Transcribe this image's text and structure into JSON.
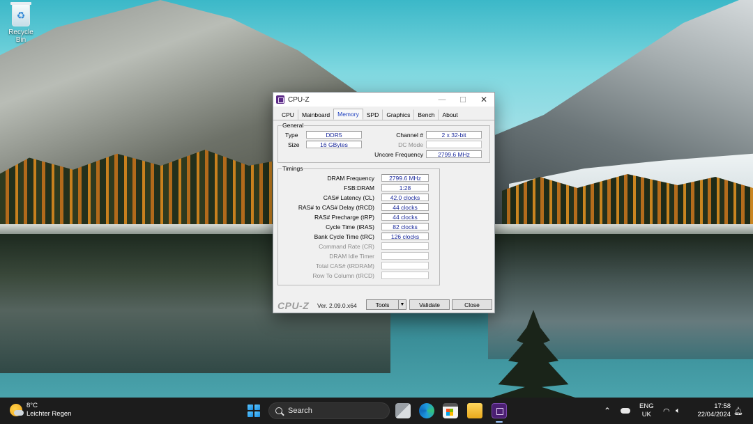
{
  "desktop": {
    "icons": [
      {
        "label": "Recycle Bin",
        "icon": "recycle-bin-icon"
      }
    ]
  },
  "window": {
    "title": "CPU-Z",
    "tabs": [
      "CPU",
      "Mainboard",
      "Memory",
      "SPD",
      "Graphics",
      "Bench",
      "About"
    ],
    "active_tab": "Memory",
    "general": {
      "label": "General",
      "type_label": "Type",
      "type_value": "DDR5",
      "size_label": "Size",
      "size_value": "16 GBytes",
      "channel_label": "Channel #",
      "channel_value": "2 x 32-bit",
      "dc_mode_label": "DC Mode",
      "dc_mode_value": "",
      "uncore_label": "Uncore Frequency",
      "uncore_value": "2799.6 MHz"
    },
    "timings": {
      "label": "Timings",
      "rows": [
        {
          "label": "DRAM Frequency",
          "value": "2799.6 MHz",
          "enabled": true
        },
        {
          "label": "FSB:DRAM",
          "value": "1:28",
          "enabled": true
        },
        {
          "label": "CAS# Latency (CL)",
          "value": "42.0 clocks",
          "enabled": true
        },
        {
          "label": "RAS# to CAS# Delay (tRCD)",
          "value": "44 clocks",
          "enabled": true
        },
        {
          "label": "RAS# Precharge (tRP)",
          "value": "44 clocks",
          "enabled": true
        },
        {
          "label": "Cycle Time (tRAS)",
          "value": "82 clocks",
          "enabled": true
        },
        {
          "label": "Bank Cycle Time (tRC)",
          "value": "126 clocks",
          "enabled": true
        },
        {
          "label": "Command Rate (CR)",
          "value": "",
          "enabled": false
        },
        {
          "label": "DRAM Idle Timer",
          "value": "",
          "enabled": false
        },
        {
          "label": "Total CAS# (tRDRAM)",
          "value": "",
          "enabled": false
        },
        {
          "label": "Row To Column (tRCD)",
          "value": "",
          "enabled": false
        }
      ]
    },
    "footer": {
      "brand": "CPU-Z",
      "version": "Ver. 2.09.0.x64",
      "tools_label": "Tools",
      "validate_label": "Validate",
      "close_label": "Close"
    }
  },
  "taskbar": {
    "weather_temp": "8°C",
    "weather_desc": "Leichter Regen",
    "search_placeholder": "Search",
    "lang_line1": "ENG",
    "lang_line2": "UK",
    "time": "17:58",
    "date": "22/04/2024",
    "accent_color": "#9cc7ff"
  }
}
